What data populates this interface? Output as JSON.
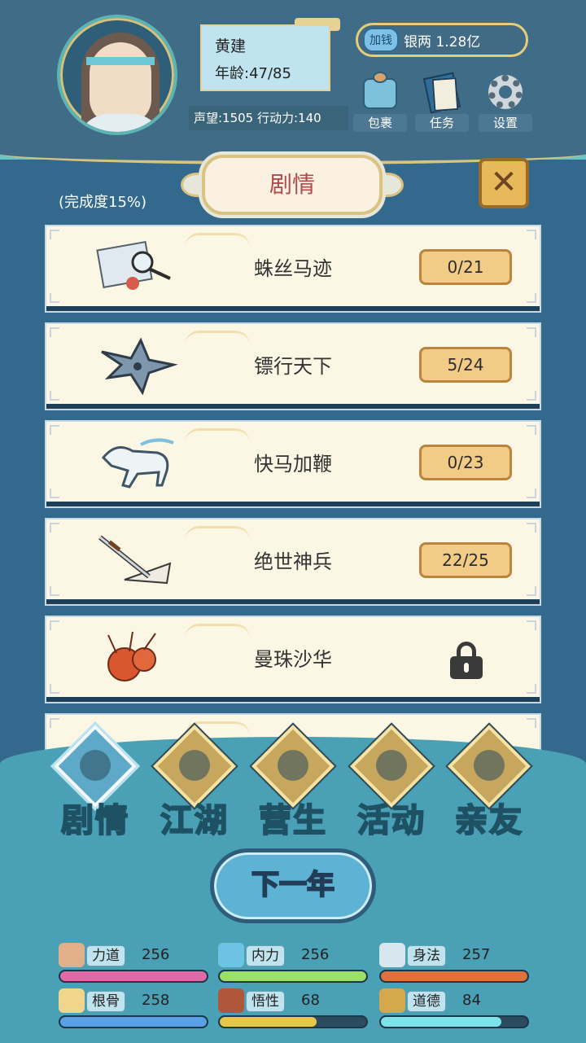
{
  "player": {
    "name": "黄建",
    "age": "年龄:47/85",
    "stats_line": "声望:1505 行动力:140"
  },
  "money": {
    "add_label": "加钱",
    "amount": "银两 1.28亿"
  },
  "top_buttons": {
    "bag": "包裹",
    "task": "任务",
    "settings": "设置"
  },
  "panel": {
    "title": "剧情",
    "close_icon": "✕",
    "progress": "(完成度15%)"
  },
  "stories": [
    {
      "title": "蛛丝马迹",
      "progress": "0/21",
      "locked": false,
      "icon": "magnifier-scroll-icon"
    },
    {
      "title": "镖行天下",
      "progress": "5/24",
      "locked": false,
      "icon": "shuriken-icon"
    },
    {
      "title": "快马加鞭",
      "progress": "0/23",
      "locked": false,
      "icon": "horse-icon"
    },
    {
      "title": "绝世神兵",
      "progress": "22/25",
      "locked": false,
      "icon": "sword-fan-icon"
    },
    {
      "title": "曼珠沙华",
      "progress": "",
      "locked": true,
      "icon": "spider-lily-icon"
    },
    {
      "title": "",
      "progress": "",
      "locked": true,
      "icon": "partial-icon"
    }
  ],
  "nav": {
    "story": "剧情",
    "jianghu": "江湖",
    "livelihood": "营生",
    "activity": "活动",
    "friends": "亲友"
  },
  "next_year": "下一年",
  "attributes": {
    "strength": {
      "label": "力道",
      "value": "256",
      "fill": 1.0,
      "color": "#e06aa8"
    },
    "inner": {
      "label": "内力",
      "value": "256",
      "fill": 1.0,
      "color": "#9be06a"
    },
    "agility": {
      "label": "身法",
      "value": "257",
      "fill": 1.0,
      "color": "#e0703e"
    },
    "bone": {
      "label": "根骨",
      "value": "258",
      "fill": 1.0,
      "color": "#5aa0e6"
    },
    "wisdom": {
      "label": "悟性",
      "value": "68",
      "fill": 0.66,
      "color": "#e8c64c"
    },
    "morality": {
      "label": "道德",
      "value": "84",
      "fill": 0.82,
      "color": "#7ee2ea"
    }
  }
}
